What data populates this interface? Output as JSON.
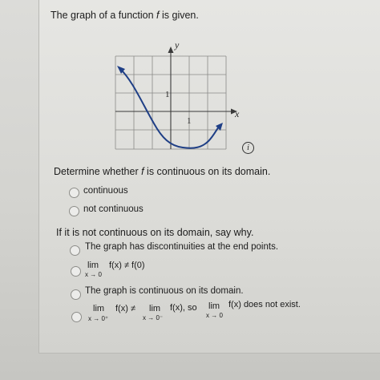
{
  "question": {
    "prefix": "The graph of a function ",
    "func": "f",
    "suffix": " is given."
  },
  "graph": {
    "y_axis_label": "y",
    "x_axis_label": "x",
    "y_tick_label": "1",
    "x_tick_label": "1",
    "curve_color": "#1f3f86",
    "info_icon": "i"
  },
  "part1": {
    "prompt_prefix": "Determine whether ",
    "prompt_func": "f",
    "prompt_suffix": " is continuous on its domain.",
    "options": [
      "continuous",
      "not continuous"
    ]
  },
  "part2": {
    "prompt": "If it is not continuous on its domain, say why.",
    "opt_a": "The graph has discontinuities at the end points.",
    "opt_b": {
      "lim": "lim",
      "sub": "x → 0",
      "expr": "f(x) ≠ f(0)"
    },
    "opt_c": "The graph is continuous on its domain.",
    "opt_d": {
      "lim1": "lim",
      "sub1": "x → 0⁺",
      "expr1": "f(x) ≠",
      "lim2": "lim",
      "sub2": "x → 0⁻",
      "expr2": "f(x), so",
      "lim3": "lim",
      "sub3": "x → 0",
      "expr3": "f(x) does not exist."
    }
  }
}
